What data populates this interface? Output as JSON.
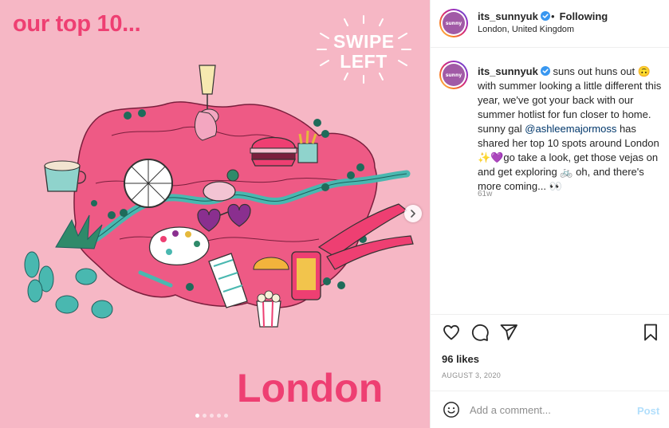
{
  "image": {
    "title": "our top 10...",
    "swipe_text": "SWIPE LEFT",
    "city": "London",
    "carousel_dots": 5,
    "active_dot": 0,
    "colors": {
      "background": "#f6b7c5",
      "accent": "#ee3f72",
      "river": "#49b8b0"
    }
  },
  "header": {
    "username": "its_sunnyuk",
    "following_label": "Following",
    "location": "London, United Kingdom",
    "avatar_text": "sunny"
  },
  "caption": {
    "username": "its_sunnyuk",
    "text_part1": " suns out huns out 🙃 with summer looking a little different this year, we've got your back with our summer hotlist for fun closer to home. sunny gal ",
    "mention": "@ashleemajormoss",
    "text_part2": " has shared her top 10 spots around London ✨💜go take a look, get those vejas on and get exploring 🚲 oh, and there's more coming... 👀",
    "time_ago": "61w"
  },
  "actions": {
    "likes": "96 likes",
    "date": "AUGUST 3, 2020"
  },
  "comment": {
    "placeholder": "Add a comment...",
    "post_label": "Post"
  }
}
